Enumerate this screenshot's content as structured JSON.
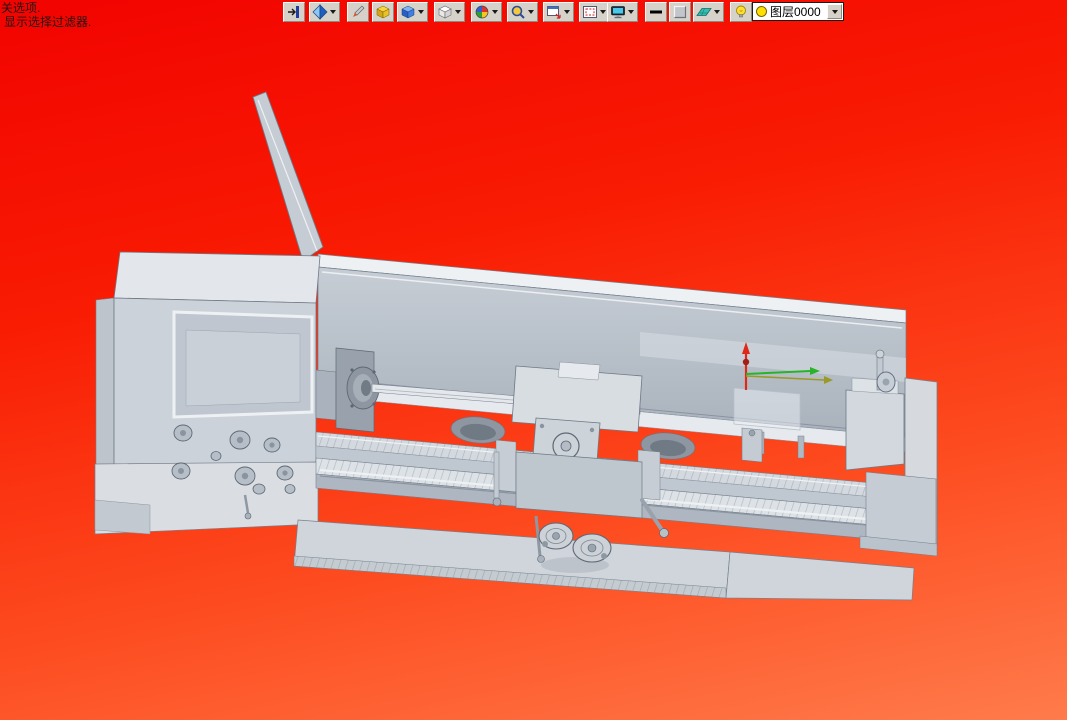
{
  "prompt": {
    "line1": "关选项.",
    "line2": "显示选择过滤器."
  },
  "toolbar": {
    "buttons": [
      {
        "icon": "exit-pick-icon",
        "dropdown": false
      },
      {
        "icon": "view-orientation-icon",
        "dropdown": true
      },
      {
        "icon": "sketch-pencil-icon",
        "dropdown": false
      },
      {
        "icon": "solid-yellow-cube-icon",
        "dropdown": false
      },
      {
        "icon": "shaded-cube-icon",
        "dropdown": true
      },
      {
        "icon": "wireframe-cube-icon",
        "dropdown": true
      },
      {
        "icon": "color-wheel-icon",
        "dropdown": true
      },
      {
        "icon": "zoom-magnifier-icon",
        "dropdown": true
      },
      {
        "icon": "zoom-window-icon",
        "dropdown": true
      },
      {
        "icon": "view-window-icon",
        "dropdown": true
      },
      {
        "icon": "monitor-icon",
        "dropdown": true
      },
      {
        "icon": "line-width-icon",
        "dropdown": false
      },
      {
        "icon": "material-swatch-icon",
        "dropdown": false
      },
      {
        "icon": "surface-teal-icon",
        "dropdown": true
      },
      {
        "icon": "lightbulb-icon",
        "dropdown": false
      }
    ],
    "layer_combo": {
      "value": "图层0000"
    }
  },
  "viewport": {
    "background_top_color": "#f20300",
    "background_bottom_color": "#ff7b4b",
    "model": "lathe-machine-3d-model",
    "model_body_color": "#ccd2d9",
    "triad": {
      "x_axis_color": "#e02818",
      "y_axis_color": "#28b428",
      "z_axis_color": "#9a9a28"
    }
  }
}
